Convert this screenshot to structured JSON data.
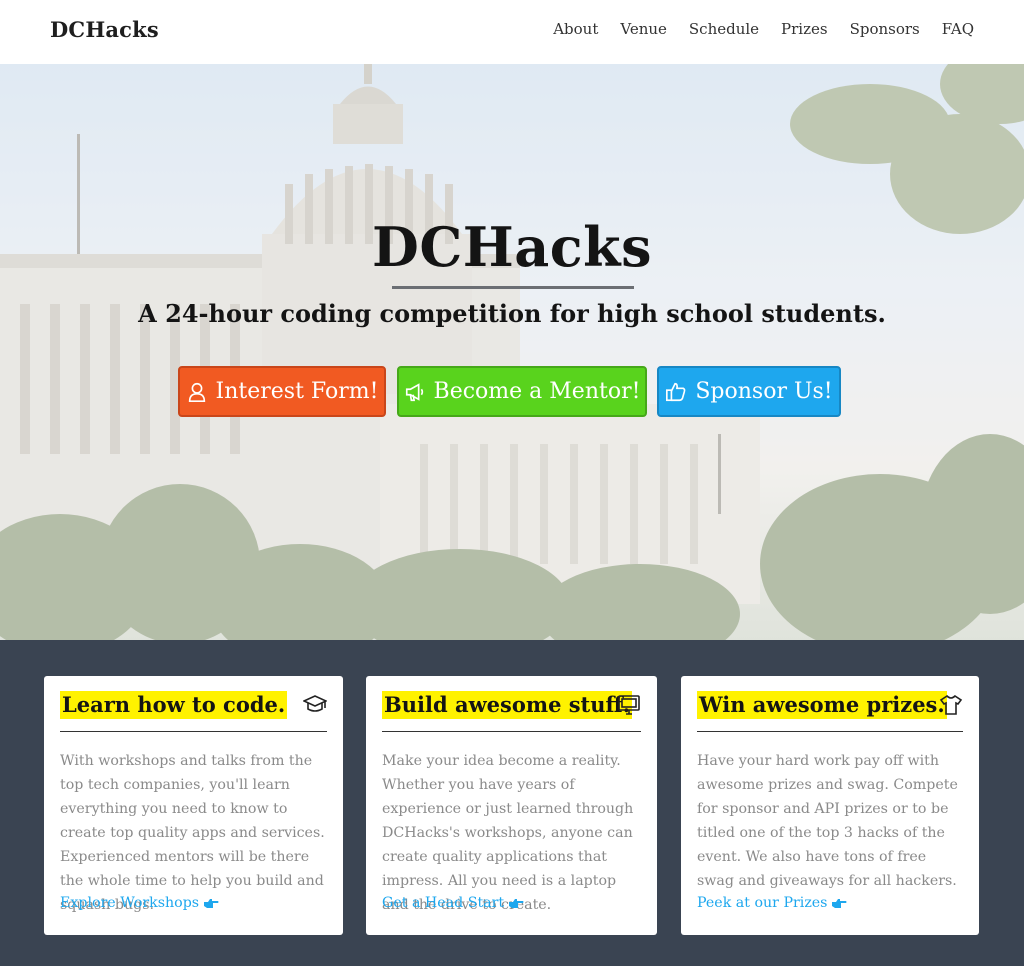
{
  "nav": {
    "brand": "DCHacks",
    "links": [
      "About",
      "Venue",
      "Schedule",
      "Prizes",
      "Sponsors",
      "FAQ"
    ]
  },
  "hero": {
    "title": "DCHacks",
    "subtitle": "A 24-hour coding competition for high school students.",
    "buttons": [
      {
        "label": "Interest Form!",
        "icon": "user-icon",
        "color": "#f15a22"
      },
      {
        "label": "Become a Mentor!",
        "icon": "megaphone-icon",
        "color": "#59d31d"
      },
      {
        "label": "Sponsor Us!",
        "icon": "thumbs-up-icon",
        "color": "#1ea7ee"
      }
    ]
  },
  "cards": [
    {
      "title": "Learn how to code.",
      "icon": "graduation-cap-icon",
      "text": "With workshops and talks from the top tech companies, you'll learn everything you need to know to create top quality apps and services. Experienced mentors will be there the whole time to help you build and squash bugs.",
      "link": "Explore Workshops"
    },
    {
      "title": "Build awesome stuff.",
      "icon": "monitor-icon",
      "text": "Make your idea become a reality. Whether you have years of experience or just learned through DCHacks's workshops, anyone can create quality applications that impress. All you need is a laptop and the drive to create.",
      "link": "Get a Head Start"
    },
    {
      "title": "Win awesome prizes.",
      "icon": "t-shirt-icon",
      "text": "Have your hard work pay off with awesome prizes and swag. Compete for sponsor and API prizes or to be titled one of the top 3 hacks of the event. We also have tons of free swag and giveaways for all hackers.",
      "link": "Peek at our Prizes"
    }
  ],
  "colors": {
    "highlight": "#fff200",
    "link": "#1ea7ee",
    "footer_bg": "#3a4452"
  }
}
